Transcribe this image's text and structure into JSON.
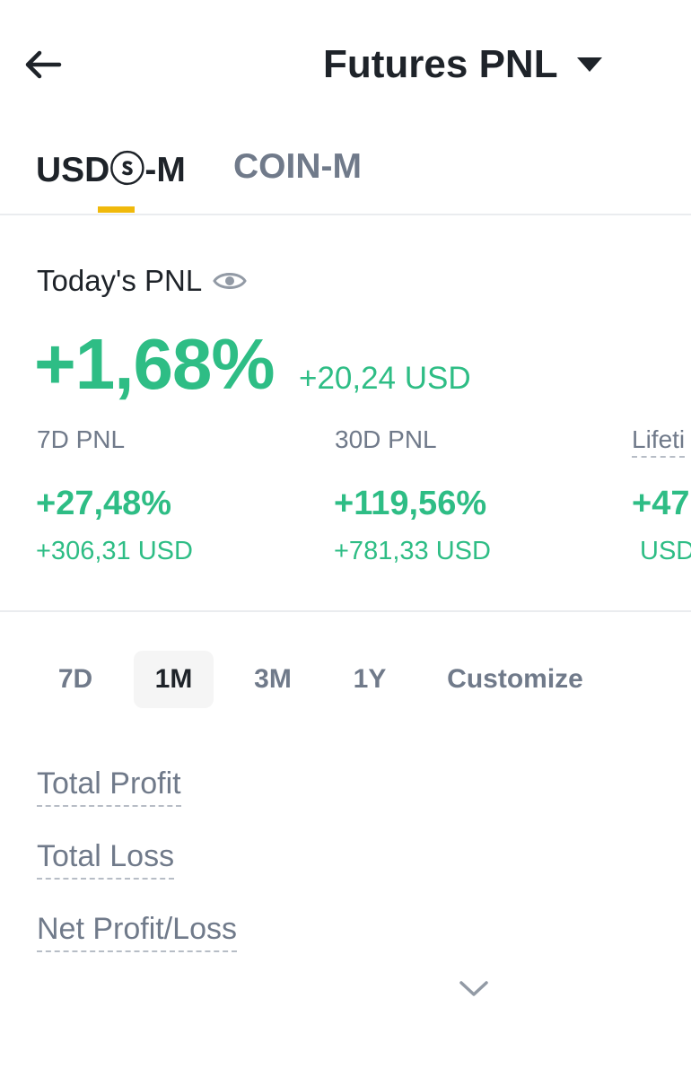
{
  "header": {
    "title": "Futures PNL",
    "back_icon": "arrow-left-icon",
    "dropdown_icon": "caret-down-icon"
  },
  "tabs": [
    {
      "label": "USDⓢ-M",
      "active": true
    },
    {
      "label": "COIN-M",
      "active": false
    }
  ],
  "today": {
    "label": "Today's PNL",
    "visibility_icon": "eye-icon",
    "percent": "+1,68%",
    "usd": "+20,24 USD"
  },
  "stats": [
    {
      "label": "7D PNL",
      "percent": "+27,48%",
      "usd": "+306,31 USD"
    },
    {
      "label": "30D PNL",
      "percent": "+119,56%",
      "usd": "+781,33 USD"
    },
    {
      "label": "Lifeti",
      "percent": "+47",
      "usd": "USD"
    }
  ],
  "periods": [
    {
      "label": "7D",
      "active": false
    },
    {
      "label": "1M",
      "active": true
    },
    {
      "label": "3M",
      "active": false
    },
    {
      "label": "1Y",
      "active": false
    },
    {
      "label": "Customize",
      "active": false
    }
  ],
  "metrics": [
    {
      "label": "Total Profit"
    },
    {
      "label": "Total Loss"
    },
    {
      "label": "Net Profit/Loss"
    }
  ],
  "expand_icon": "chevron-down-icon",
  "colors": {
    "positive": "#2ebd85",
    "accent": "#f0b90b",
    "text_primary": "#1e2329",
    "text_secondary": "#707a8a"
  }
}
